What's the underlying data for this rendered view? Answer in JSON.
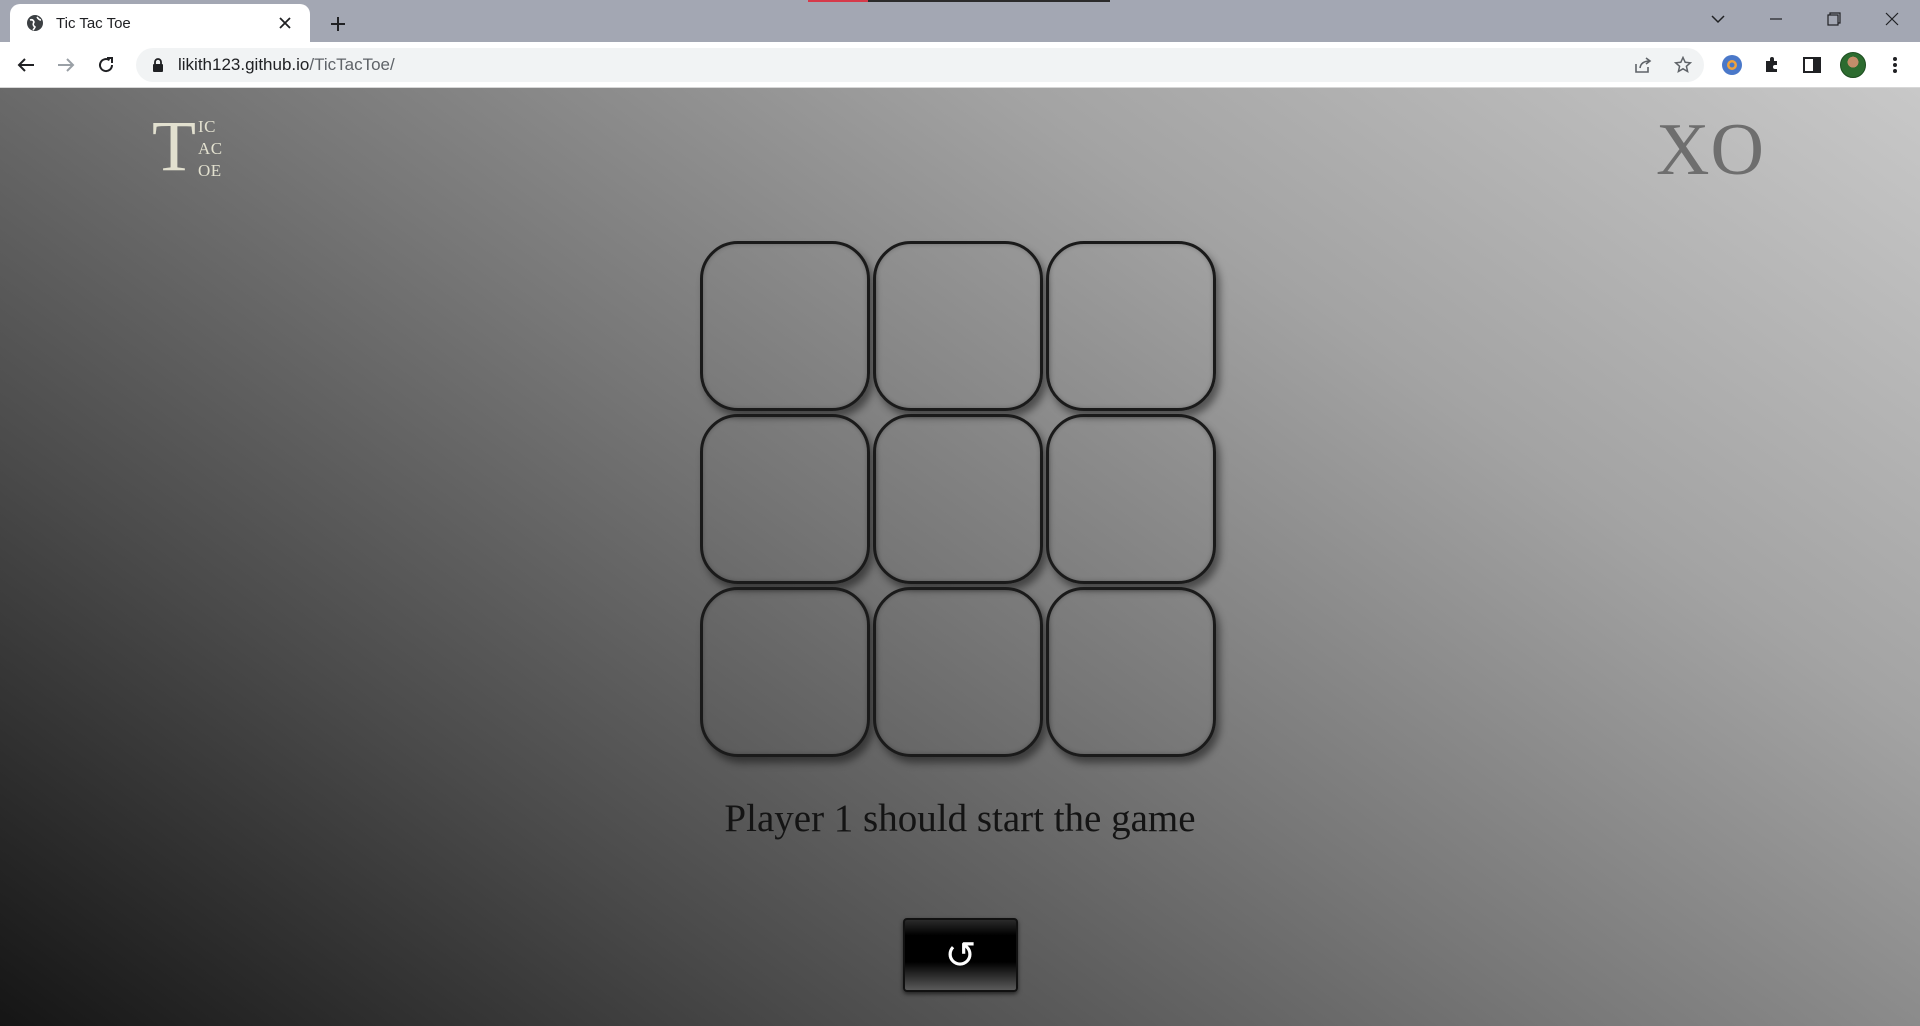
{
  "browser": {
    "tab_title": "Tic Tac Toe",
    "url_host": "likith123.github.io",
    "url_path": "/TicTacToe/"
  },
  "logo": {
    "big_letter": "T",
    "lines": [
      "IC",
      "AC",
      "OE"
    ]
  },
  "header_right": "XO",
  "board": {
    "cells": [
      "",
      "",
      "",
      "",
      "",
      "",
      "",
      "",
      ""
    ]
  },
  "status_text": "Player 1 should start the game",
  "reset_button": {
    "label": "↺"
  }
}
